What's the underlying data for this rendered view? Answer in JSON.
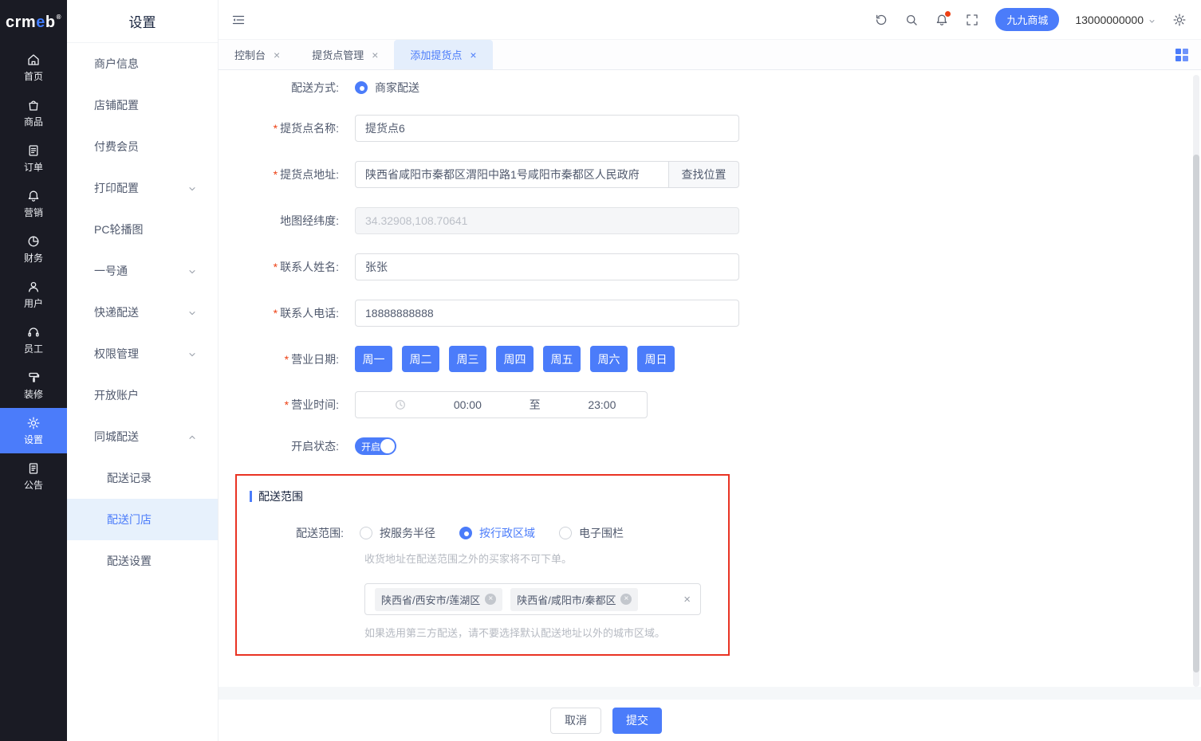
{
  "brand": {
    "logo_prefix": "crm",
    "logo_accent": "e",
    "logo_suffix": "b",
    "reg_mark": "®"
  },
  "primary_nav": {
    "items": [
      {
        "label": "首页",
        "icon": "home-icon",
        "active": false
      },
      {
        "label": "商品",
        "icon": "product-icon",
        "active": false
      },
      {
        "label": "订单",
        "icon": "order-icon",
        "active": false
      },
      {
        "label": "营销",
        "icon": "marketing-icon",
        "active": false
      },
      {
        "label": "财务",
        "icon": "finance-icon",
        "active": false
      },
      {
        "label": "用户",
        "icon": "user-icon",
        "active": false
      },
      {
        "label": "员工",
        "icon": "staff-icon",
        "active": false
      },
      {
        "label": "装修",
        "icon": "decorate-icon",
        "active": false
      },
      {
        "label": "设置",
        "icon": "settings-icon",
        "active": true
      },
      {
        "label": "公告",
        "icon": "announcement-icon",
        "active": false
      }
    ]
  },
  "secondary_nav": {
    "title": "设置",
    "items": [
      {
        "label": "商户信息"
      },
      {
        "label": "店铺配置"
      },
      {
        "label": "付费会员"
      },
      {
        "label": "打印配置",
        "expandable": true
      },
      {
        "label": "PC轮播图"
      },
      {
        "label": "一号通",
        "expandable": true
      },
      {
        "label": "快递配送",
        "expandable": true
      },
      {
        "label": "权限管理",
        "expandable": true
      },
      {
        "label": "开放账户"
      },
      {
        "label": "同城配送",
        "expandable": true,
        "expanded": true
      },
      {
        "label": "配送记录",
        "child": true
      },
      {
        "label": "配送门店",
        "child": true,
        "active": true
      },
      {
        "label": "配送设置",
        "child": true
      }
    ]
  },
  "topbar": {
    "store_badge": "九九商城",
    "account_phone": "13000000000"
  },
  "tabs": {
    "close_glyph": "×",
    "items": [
      {
        "label": "控制台",
        "active": false
      },
      {
        "label": "提货点管理",
        "active": false
      },
      {
        "label": "添加提货点",
        "active": true
      }
    ]
  },
  "form": {
    "required_mark": "*",
    "delivery_method": {
      "label": "配送方式:",
      "option": "商家配送",
      "selected": true
    },
    "pickup_name": {
      "label": "提货点名称:",
      "value": "提货点6"
    },
    "pickup_address": {
      "label": "提货点地址:",
      "value": "陕西省咸阳市秦都区渭阳中路1号咸阳市秦都区人民政府",
      "button_label": "查找位置"
    },
    "coordinates": {
      "label": "地图经纬度:",
      "value": "34.32908,108.70641",
      "disabled": true
    },
    "contact_name": {
      "label": "联系人姓名:",
      "value": "张张"
    },
    "contact_phone": {
      "label": "联系人电话:",
      "value": "18888888888"
    },
    "business_days": {
      "label": "营业日期:",
      "options": [
        "周一",
        "周二",
        "周三",
        "周四",
        "周五",
        "周六",
        "周日"
      ],
      "all_selected": true
    },
    "business_hours": {
      "label": "营业时间:",
      "start": "00:00",
      "separator": "至",
      "end": "23:00"
    },
    "status": {
      "label": "开启状态:",
      "toggle_label": "开启",
      "on": true
    }
  },
  "delivery_scope": {
    "section_title": "配送范围",
    "field_label": "配送范围:",
    "options": [
      {
        "label": "按服务半径",
        "selected": false
      },
      {
        "label": "按行政区域",
        "selected": true
      },
      {
        "label": "电子围栏",
        "selected": false
      }
    ],
    "hint_top": "收货地址在配送范围之外的买家将不可下单。",
    "regions": [
      "陕西省/西安市/莲湖区",
      "陕西省/咸阳市/秦都区"
    ],
    "tag_close_glyph": "×",
    "clear_glyph": "×",
    "hint_bottom": "如果选用第三方配送，请不要选择默认配送地址以外的城市区域。"
  },
  "footer": {
    "cancel_label": "取消",
    "submit_label": "提交"
  },
  "colors": {
    "accent": "#4b7cfa",
    "rail_bg": "#1a1b24",
    "highlight_border": "#e93323",
    "active_tab_bg": "#e4eefc",
    "danger": "#ed4014"
  }
}
